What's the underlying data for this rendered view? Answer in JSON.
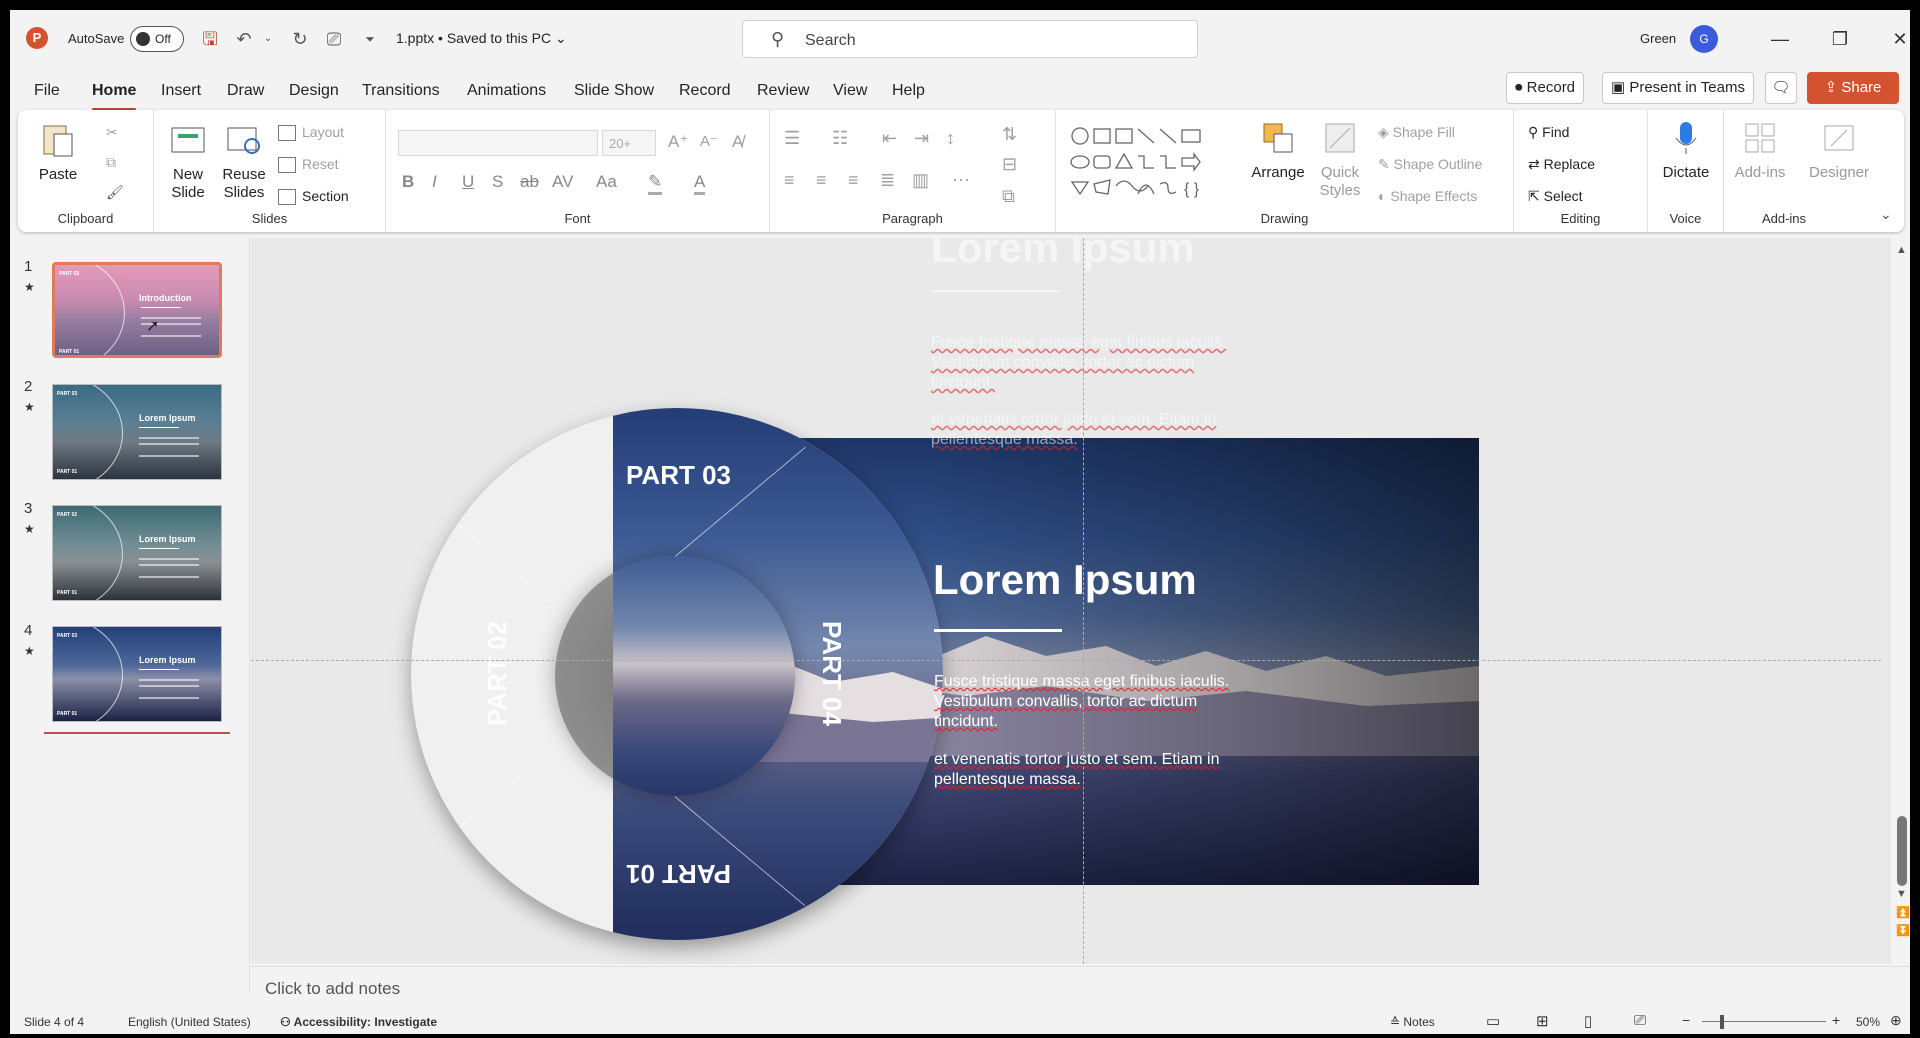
{
  "app": {
    "name": "PowerPoint",
    "logo_letter": "P"
  },
  "titlebar": {
    "autosave_label": "AutoSave",
    "autosave_state": "Off",
    "filename": "1.pptx • Saved to this PC ⌄",
    "search_placeholder": "Search",
    "user_name": "Green",
    "user_initial": "G"
  },
  "menu": {
    "tabs": [
      "File",
      "Home",
      "Insert",
      "Draw",
      "Design",
      "Transitions",
      "Animations",
      "Slide Show",
      "Record",
      "Review",
      "View",
      "Help"
    ],
    "active": "Home",
    "record_button": "Record",
    "present_teams_button": "Present in Teams",
    "share_button": "Share"
  },
  "ribbon": {
    "clipboard": {
      "paste": "Paste",
      "label": "Clipboard"
    },
    "slides": {
      "new_slide": "New Slide",
      "reuse_slides": "Reuse Slides",
      "layout": "Layout",
      "reset": "Reset",
      "section": "Section",
      "label": "Slides"
    },
    "font": {
      "size": "20+",
      "label": "Font"
    },
    "paragraph": {
      "label": "Paragraph"
    },
    "drawing": {
      "arrange": "Arrange",
      "quick_styles": "Quick Styles",
      "shape_fill": "Shape Fill",
      "shape_outline": "Shape Outline",
      "shape_effects": "Shape Effects",
      "label": "Drawing"
    },
    "editing": {
      "find": "Find",
      "replace": "Replace",
      "select": "Select",
      "label": "Editing"
    },
    "voice": {
      "dictate": "Dictate",
      "label": "Voice"
    },
    "addins": {
      "addins": "Add-ins",
      "designer": "Designer",
      "label": "Add-ins"
    }
  },
  "slides_panel": {
    "slides": [
      {
        "num": "1",
        "title": "Introduction",
        "p1": "PART 01",
        "p3": "PART 03"
      },
      {
        "num": "2",
        "title": "Lorem Ipsum",
        "p1": "PART 01",
        "p3": "PART 03"
      },
      {
        "num": "3",
        "title": "Lorem Ipsum",
        "p1": "PART 01",
        "p3": "PART 02"
      },
      {
        "num": "4",
        "title": "Lorem Ipsum",
        "p1": "PART 01",
        "p3": "PART 03"
      }
    ],
    "selected": 1
  },
  "slide": {
    "title": "Lorem Ipsum",
    "body1_a": "Fusce tristique massa eget finibus iaculis.",
    "body1_b": "Vestibulum convallis, tortor ac dictum",
    "body1_c": "tincidunt.",
    "body2_a": "et venenatis tortor justo et sem. Etiam in",
    "body2_b": "pellentesque massa.",
    "part01": "PART 01",
    "part02": "PART 02",
    "part03": "PART 03",
    "part04": "PART 04"
  },
  "notes": {
    "placeholder": "Click to add notes"
  },
  "status": {
    "slide_info": "Slide 4 of 4",
    "language": "English (United States)",
    "accessibility": "Accessibility: Investigate",
    "notes_button": "Notes",
    "zoom": "50%"
  },
  "colors": {
    "accent": "#d35230",
    "tab_underline": "#b7472a"
  }
}
